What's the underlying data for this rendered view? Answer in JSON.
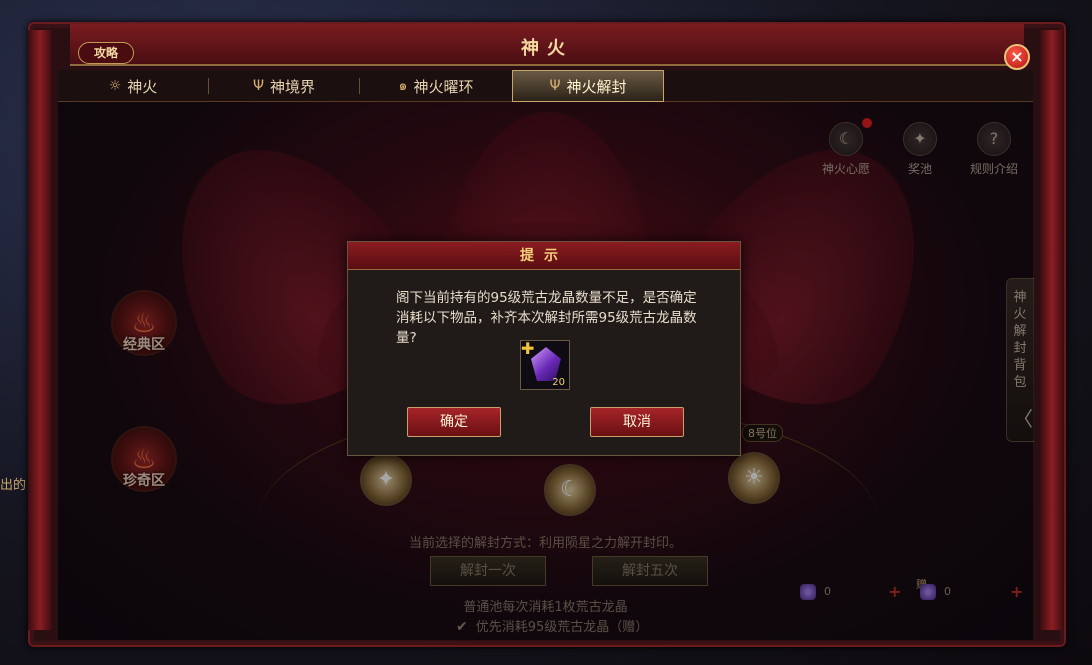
{
  "window": {
    "title": "神火",
    "guide_label": "攻略",
    "close_label": "×"
  },
  "tabs": [
    {
      "label": "神火",
      "icon": "☼"
    },
    {
      "label": "神境界",
      "icon": "Ψ"
    },
    {
      "label": "神火曜环",
      "icon": "๑"
    },
    {
      "label": "神火解封",
      "icon": "Ψ",
      "active": true
    }
  ],
  "top_icons": [
    {
      "label": "神火心愿",
      "icon": "☾"
    },
    {
      "label": "奖池",
      "icon": "✦"
    },
    {
      "label": "规则介绍",
      "icon": "?"
    }
  ],
  "zones": [
    {
      "label": "经典区",
      "icon": "♨"
    },
    {
      "label": "珍奇区",
      "icon": "♨"
    }
  ],
  "seals": {
    "left": "✦",
    "middle": "☾",
    "right": "☀"
  },
  "position_tag": "8号位",
  "unseal": {
    "method_text": "当前选择的解封方式：利用陨星之力解开封印。",
    "once_label": "解封一次",
    "five_label": "解封五次",
    "cost_text": "普通池每次消耗1枚荒古龙晶",
    "priority_text": "优先消耗95级荒古龙晶（赠）"
  },
  "resources": {
    "count_a": "0",
    "count_b": "0",
    "gift_label": "赠"
  },
  "side_tab": {
    "label": "神火解封背包",
    "arrow": "〈"
  },
  "outside": {
    "left_text": "出的",
    "top_right_text": "…"
  },
  "dialog": {
    "title": "提示",
    "message": "阁下当前持有的95级荒古龙晶数量不足，是否确定消耗以下物品，补齐本次解封所需95级荒古龙晶数量?",
    "item_count": "20",
    "confirm_label": "确定",
    "cancel_label": "取消"
  }
}
